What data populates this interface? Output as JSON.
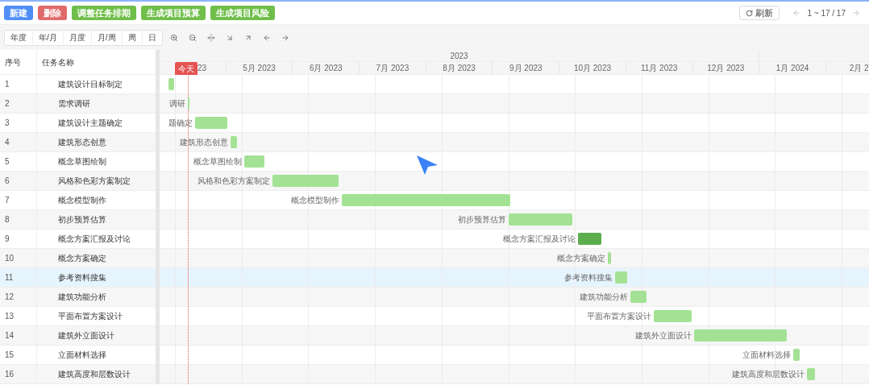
{
  "toolbar": {
    "buttons": [
      {
        "label": "新建",
        "kind": "primary"
      },
      {
        "label": "删除",
        "kind": "danger"
      },
      {
        "label": "调整任务排期",
        "kind": "success"
      },
      {
        "label": "生成项目预算",
        "kind": "success"
      },
      {
        "label": "生成项目风险",
        "kind": "success"
      }
    ],
    "refresh": {
      "label": "刷新"
    },
    "pagination": {
      "range": "1 ~ 17 / 17"
    }
  },
  "view_modes": [
    {
      "label": "年度",
      "selected": false
    },
    {
      "label": "年/月",
      "selected": false
    },
    {
      "label": "月度",
      "selected": false
    },
    {
      "label": "月/周",
      "selected": false
    },
    {
      "label": "周",
      "selected": false
    },
    {
      "label": "日",
      "selected": false
    }
  ],
  "table": {
    "columns": [
      "序号",
      "任务名称"
    ]
  },
  "timeline": {
    "year": "2023",
    "today": "今天",
    "months": [
      "23",
      "5月 2023",
      "6月 2023",
      "7月 2023",
      "8月 2023",
      "9月 2023",
      "10月 2023",
      "11月 2023",
      "12月 2023",
      "1月 2024",
      "2月 2"
    ]
  },
  "tasks": [
    {
      "seq": "1",
      "name": "建筑设计目标制定",
      "color": "#a3e294",
      "selected": false
    },
    {
      "seq": "2",
      "name": "需求调研",
      "bar_label": "调研",
      "color": "#a3e294",
      "selected": false
    },
    {
      "seq": "3",
      "name": "建筑设计主题确定",
      "bar_label": "题确定",
      "color": "#a3e294",
      "selected": false
    },
    {
      "seq": "4",
      "name": "建筑形态创意",
      "bar_label": "建筑形态创意",
      "color": "#a3e294",
      "selected": false
    },
    {
      "seq": "5",
      "name": "概念草图绘制",
      "bar_label": "概念草图绘制",
      "color": "#a3e294",
      "selected": false
    },
    {
      "seq": "6",
      "name": "风格和色彩方案制定",
      "bar_label": "风格和色彩方案制定",
      "color": "#a3e294",
      "selected": false
    },
    {
      "seq": "7",
      "name": "概念模型制作",
      "bar_label": "概念模型制作",
      "color": "#a3e294",
      "selected": false
    },
    {
      "seq": "8",
      "name": "初步预算估算",
      "bar_label": "初步预算估算",
      "color": "#a3e294",
      "selected": false
    },
    {
      "seq": "9",
      "name": "概念方案汇报及讨论",
      "bar_label": "概念方案汇报及讨论",
      "color": "#5cad4e",
      "selected": false
    },
    {
      "seq": "10",
      "name": "概念方案确定",
      "bar_label": "概念方案确定",
      "color": "#a3e294",
      "selected": false
    },
    {
      "seq": "11",
      "name": "参考资料搜集",
      "bar_label": "参考资料搜集",
      "color": "#a3e294",
      "selected": true
    },
    {
      "seq": "12",
      "name": "建筑功能分析",
      "bar_label": "建筑功能分析",
      "color": "#a3e294",
      "selected": false
    },
    {
      "seq": "13",
      "name": "平面布置方案设计",
      "bar_label": "平面布置方案设计",
      "color": "#a3e294",
      "selected": false
    },
    {
      "seq": "14",
      "name": "建筑外立面设计",
      "bar_label": "建筑外立面设计",
      "color": "#a3e294",
      "selected": false
    },
    {
      "seq": "15",
      "name": "立面材料选择",
      "bar_label": "立面材料选择",
      "color": "#a3e294",
      "selected": false
    },
    {
      "seq": "16",
      "name": "建筑高度和层数设计",
      "bar_label": "建筑高度和层数设计",
      "color": "#a3e294",
      "selected": false
    }
  ]
}
